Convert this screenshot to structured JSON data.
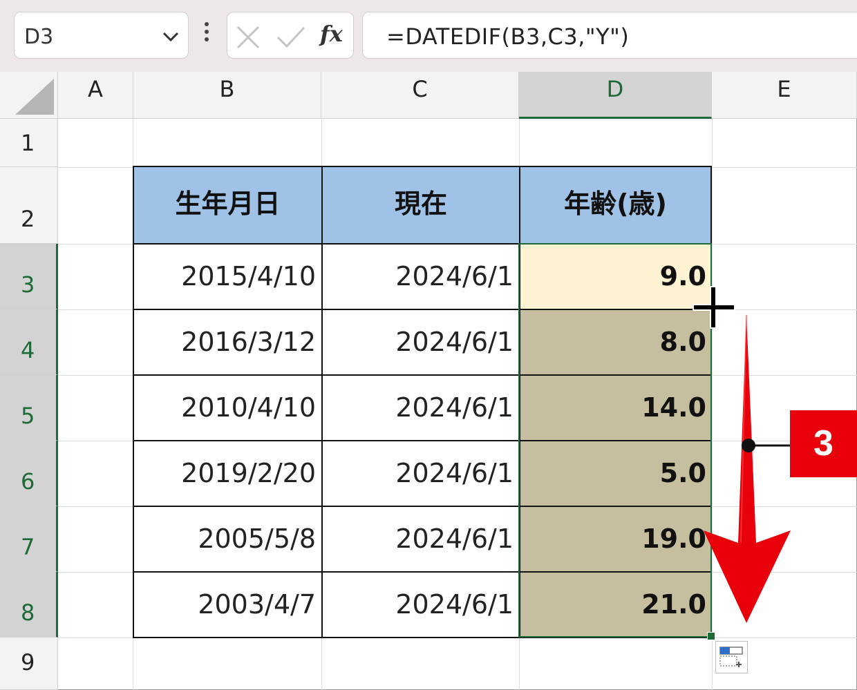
{
  "formula_bar": {
    "name_box": "D3",
    "formula": "=DATEDIF(B3,C3,\"Y\")",
    "fx_label": "fx"
  },
  "columns": [
    "A",
    "B",
    "C",
    "D",
    "E"
  ],
  "rows": [
    "1",
    "2",
    "3",
    "4",
    "5",
    "6",
    "7",
    "8",
    "9"
  ],
  "selected_column": "D",
  "table": {
    "headers": [
      "生年月日",
      "現在",
      "年齢(歳)"
    ],
    "rows": [
      {
        "birth": "2015/4/10",
        "now": "2024/6/1",
        "age": "9.0"
      },
      {
        "birth": "2016/3/12",
        "now": "2024/6/1",
        "age": "8.0"
      },
      {
        "birth": "2010/4/10",
        "now": "2024/6/1",
        "age": "14.0"
      },
      {
        "birth": "2019/2/20",
        "now": "2024/6/1",
        "age": "5.0"
      },
      {
        "birth": "2005/5/8",
        "now": "2024/6/1",
        "age": "19.0"
      },
      {
        "birth": "2003/4/7",
        "now": "2024/6/1",
        "age": "21.0"
      }
    ]
  },
  "annotation": {
    "step_number": "3",
    "color": "#e8000a"
  },
  "colors": {
    "header_fill": "#9fc2e6",
    "selection_fill": "#c6bf9f",
    "active_cell_fill": "#fdf2d2",
    "selection_border": "#1d6a37"
  },
  "icons": [
    "chevron-down-icon",
    "more-options-icon",
    "cancel-icon",
    "enter-icon",
    "fx-icon",
    "fill-handle-cursor-icon",
    "auto-fill-options-icon",
    "down-arrow-icon"
  ]
}
